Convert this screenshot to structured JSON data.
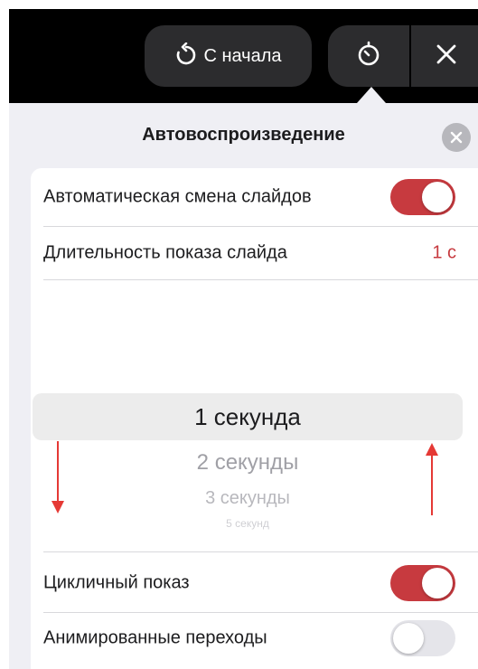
{
  "toolbar": {
    "restart_label": "С начала",
    "icons": {
      "restart": "restart-arrow-icon",
      "timer": "stopwatch-icon",
      "close": "close-x-icon"
    }
  },
  "panel": {
    "title": "Автовоспроизведение",
    "close_icon": "close-circle-icon",
    "auto_advance": {
      "label": "Автоматическая смена слайдов",
      "on": true
    },
    "slide_duration": {
      "label": "Длительность показа слайда",
      "value": "1 с"
    },
    "picker": {
      "selected": "1 секунда",
      "next1": "2 секунды",
      "next2": "3 секунды",
      "next3": "5 секунд"
    },
    "loop": {
      "label": "Цикличный показ",
      "on": true
    },
    "animated_transitions": {
      "label": "Анимированные переходы",
      "on": false
    }
  },
  "colors": {
    "accent": "#c73a3f",
    "annotation": "#e53935",
    "toolbar_bg": "#000000",
    "pill_bg": "#2c2c2e",
    "panel_bg": "#efeff4"
  }
}
